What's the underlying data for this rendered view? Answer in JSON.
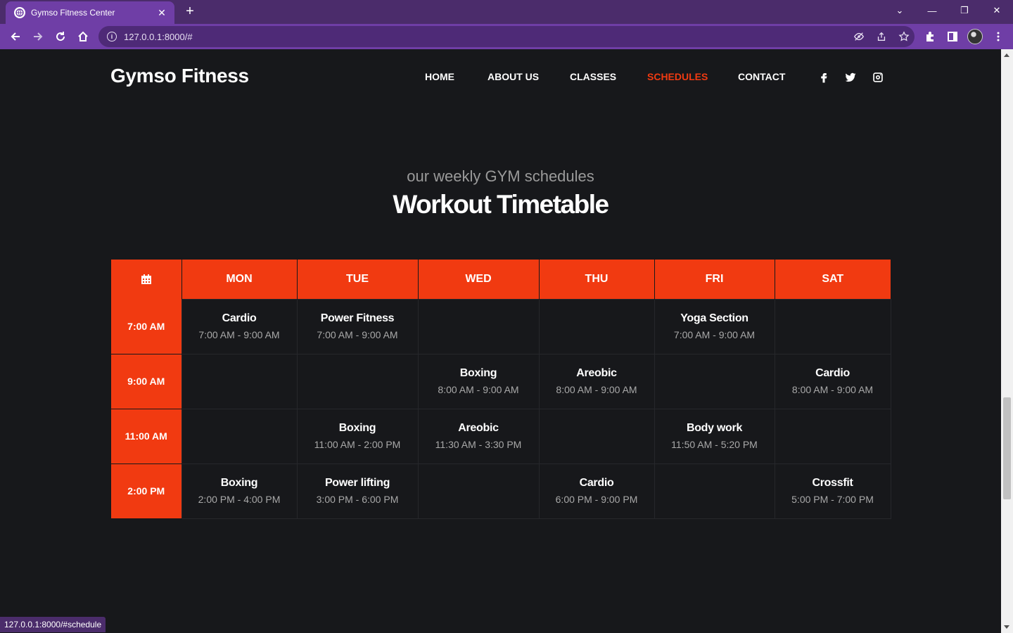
{
  "browser": {
    "tab_title": "Gymso Fitness Center",
    "tab_close": "✕",
    "new_tab": "+",
    "url": "127.0.0.1:8000/#",
    "status_url": "127.0.0.1:8000/#schedule",
    "window_controls": [
      "⌄",
      "—",
      "❐",
      "✕"
    ]
  },
  "header": {
    "brand": "Gymso Fitness",
    "nav": [
      {
        "label": "HOME",
        "active": false
      },
      {
        "label": "ABOUT US",
        "active": false
      },
      {
        "label": "CLASSES",
        "active": false
      },
      {
        "label": "SCHEDULES",
        "active": true
      },
      {
        "label": "CONTACT",
        "active": false
      }
    ],
    "social_icons": [
      "facebook-icon",
      "twitter-icon",
      "instagram-icon"
    ]
  },
  "section": {
    "subtitle": "our weekly GYM schedules",
    "title": "Workout Timetable"
  },
  "timetable": {
    "header_icon": "calendar-icon",
    "days": [
      "MON",
      "TUE",
      "WED",
      "THU",
      "FRI",
      "SAT"
    ],
    "rows": [
      {
        "time": "7:00 AM",
        "cells": [
          {
            "name": "Cardio",
            "time": "7:00 AM - 9:00 AM"
          },
          {
            "name": "Power Fitness",
            "time": "7:00 AM - 9:00 AM"
          },
          null,
          null,
          {
            "name": "Yoga Section",
            "time": "7:00 AM - 9:00 AM"
          },
          null
        ]
      },
      {
        "time": "9:00 AM",
        "cells": [
          null,
          null,
          {
            "name": "Boxing",
            "time": "8:00 AM - 9:00 AM"
          },
          {
            "name": "Areobic",
            "time": "8:00 AM - 9:00 AM"
          },
          null,
          {
            "name": "Cardio",
            "time": "8:00 AM - 9:00 AM"
          }
        ]
      },
      {
        "time": "11:00 AM",
        "cells": [
          null,
          {
            "name": "Boxing",
            "time": "11:00 AM - 2:00 PM"
          },
          {
            "name": "Areobic",
            "time": "11:30 AM - 3:30 PM"
          },
          null,
          {
            "name": "Body work",
            "time": "11:50 AM - 5:20 PM"
          },
          null
        ]
      },
      {
        "time": "2:00 PM",
        "cells": [
          {
            "name": "Boxing",
            "time": "2:00 PM - 4:00 PM"
          },
          {
            "name": "Power lifting",
            "time": "3:00 PM - 6:00 PM"
          },
          null,
          {
            "name": "Cardio",
            "time": "6:00 PM - 9:00 PM"
          },
          null,
          {
            "name": "Crossfit",
            "time": "5:00 PM - 7:00 PM"
          }
        ]
      }
    ]
  },
  "colors": {
    "accent": "#f13a11",
    "background": "#17181b",
    "browser_frame": "#6f3ea6"
  }
}
